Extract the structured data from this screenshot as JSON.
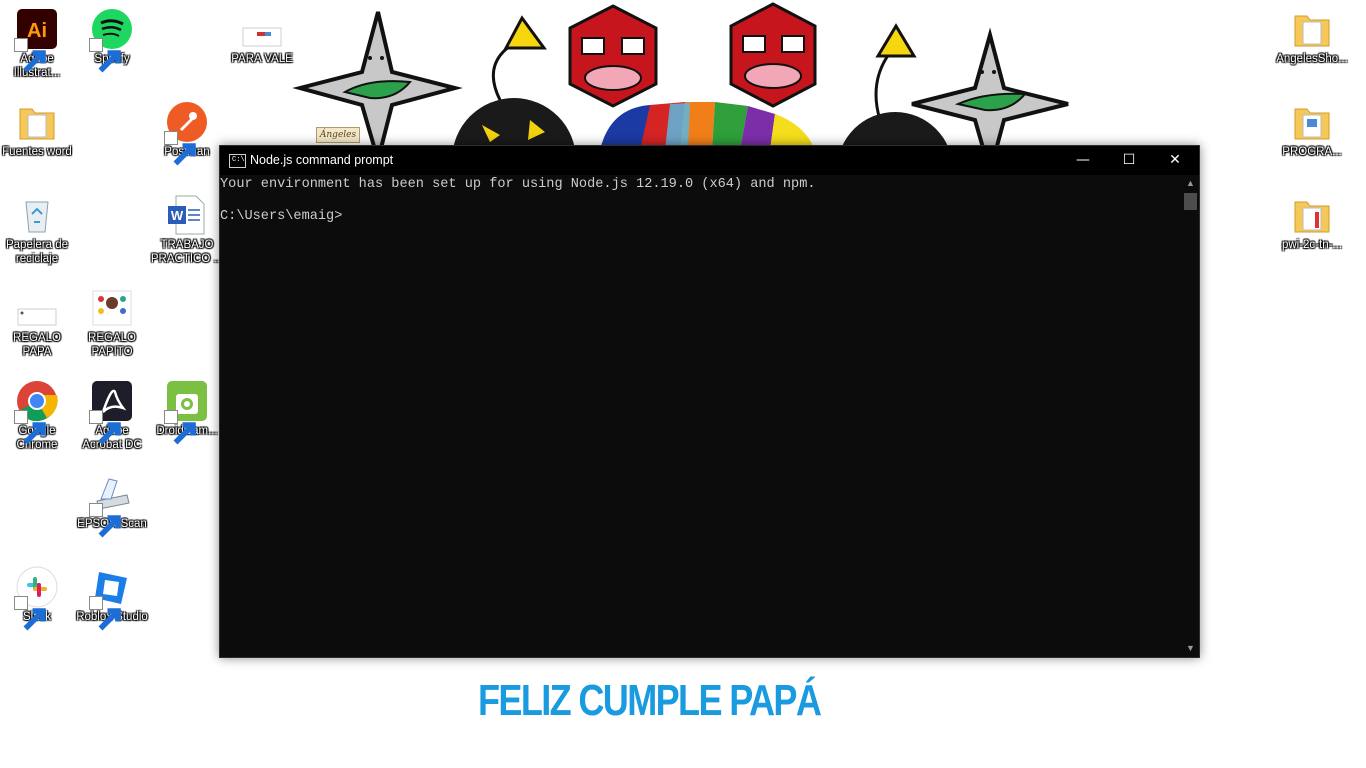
{
  "desktop": {
    "icons": [
      {
        "label": "Adobe Illustrat...",
        "icon": "adobe-illustrator-icon"
      },
      {
        "label": "Spotify",
        "icon": "spotify-icon"
      },
      {
        "label": "PARA VALE",
        "icon": "image-file-icon"
      },
      {
        "label": "Fuentes word",
        "icon": "folder-icon"
      },
      {
        "label": "Postman",
        "icon": "postman-icon"
      },
      {
        "label": "Papelera de reciclaje",
        "icon": "recycle-bin-icon"
      },
      {
        "label": "TRABAJO PRACTICO ...",
        "icon": "word-document-icon"
      },
      {
        "label": "REGALO PAPA",
        "icon": "image-file-icon"
      },
      {
        "label": "REGALO PAPITO",
        "icon": "image-file-icon"
      },
      {
        "label": "Google Chrome",
        "icon": "chrome-icon"
      },
      {
        "label": "Adobe Acrobat DC",
        "icon": "acrobat-icon"
      },
      {
        "label": "DroidCam...",
        "icon": "droidcam-icon"
      },
      {
        "label": "EPSON Scan",
        "icon": "scanner-icon"
      },
      {
        "label": "Slack",
        "icon": "slack-icon"
      },
      {
        "label": "Roblox Studio",
        "icon": "roblox-studio-icon"
      },
      {
        "label": "AngelesSho...",
        "icon": "folder-icon"
      },
      {
        "label": "PROGRA...",
        "icon": "folder-icon"
      },
      {
        "label": "pwi-2c-tn-...",
        "icon": "folder-icon"
      }
    ]
  },
  "wallpaper": {
    "greeting": "FELIZ CUMPLE PAPÁ",
    "signature": "Ángeles",
    "greeting_color": "#1a9be0"
  },
  "cmd_window": {
    "title": "Node.js command prompt",
    "title_icon_text": "C:\\",
    "minimize": "—",
    "maximize": "☐",
    "close": "✕",
    "output_line": "Your environment has been set up for using Node.js 12.19.0 (x64) and npm.",
    "prompt": "C:\\Users\\emaig>",
    "scroll_up": "▲",
    "scroll_down": "▼"
  }
}
